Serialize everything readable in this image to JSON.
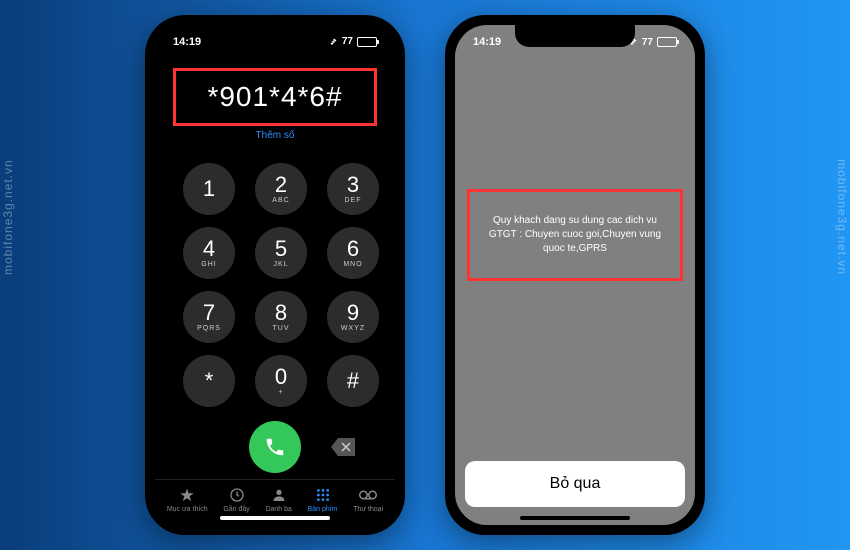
{
  "watermark_text": "mobifone3g.net.vn",
  "statusbar": {
    "time": "14:19",
    "battery": "77"
  },
  "dialer": {
    "entered_number": "*901*4*6#",
    "add_number_label": "Thêm số",
    "keys": [
      {
        "num": "1",
        "sub": ""
      },
      {
        "num": "2",
        "sub": "ABC"
      },
      {
        "num": "3",
        "sub": "DEF"
      },
      {
        "num": "4",
        "sub": "GHI"
      },
      {
        "num": "5",
        "sub": "JKL"
      },
      {
        "num": "6",
        "sub": "MNO"
      },
      {
        "num": "7",
        "sub": "PQRS"
      },
      {
        "num": "8",
        "sub": "TUV"
      },
      {
        "num": "9",
        "sub": "WXYZ"
      },
      {
        "num": "*",
        "sub": ""
      },
      {
        "num": "0",
        "sub": "+"
      },
      {
        "num": "#",
        "sub": ""
      }
    ]
  },
  "tabs": {
    "favorites": "Mục ưa thích",
    "recents": "Gần đây",
    "contacts": "Danh bạ",
    "keypad": "Bàn phím",
    "voicemail": "Thư thoại"
  },
  "ussd": {
    "message": "Quy khach dang su dung cac dich vu GTGT : Chuyen cuoc goi,Chuyen vung quoc te,GPRS",
    "dismiss": "Bỏ qua"
  }
}
